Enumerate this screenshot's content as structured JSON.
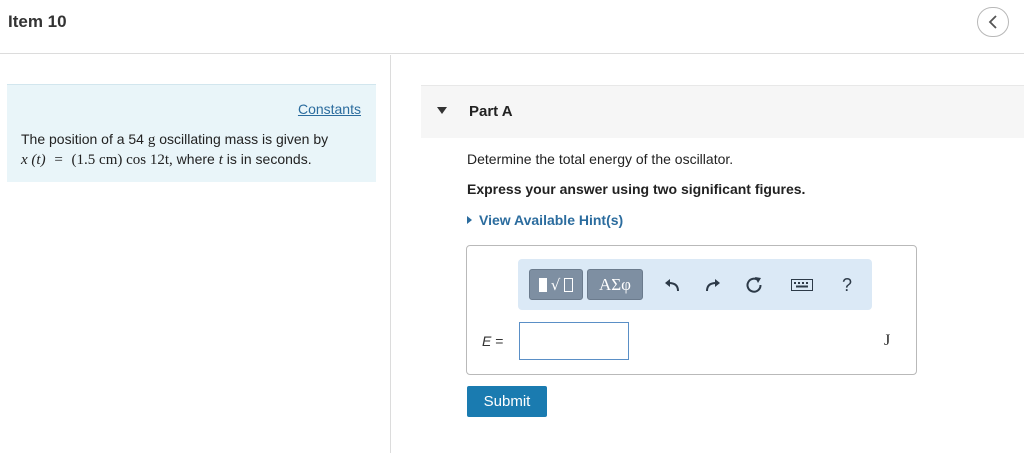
{
  "header": {
    "title": "Item 10",
    "back_icon": "chevron-left-icon"
  },
  "constants": {
    "link_label": "Constants",
    "text_line1_prefix": "The position of a 54",
    "text_line1_unit": "g",
    "text_line1_suffix": "oscillating mass is given by",
    "eq_lhs": "x (t)",
    "eq_equals": "=",
    "eq_rhs": "(1.5 cm) cos 12t,",
    "text_line2_middle": "where",
    "text_line2_var": "t",
    "text_line2_suffix": "is in seconds."
  },
  "part": {
    "title": "Part A",
    "caret_icon": "caret-down-icon",
    "question": "Determine the total energy of the oscillator.",
    "instruction": "Express your answer using two significant figures.",
    "hint_label": "View Available Hint(s)"
  },
  "toolbar": {
    "templates_icon": "templates-icon",
    "symbols_label": "ΑΣφ",
    "undo_icon": "undo-icon",
    "redo_icon": "redo-icon",
    "reset_icon": "reset-icon",
    "keyboard_icon": "keyboard-icon",
    "help_label": "?"
  },
  "answer": {
    "variable": "E",
    "equals": "=",
    "value": "",
    "unit": "J"
  },
  "submit_label": "Submit",
  "colors": {
    "accent": "#1a7bb0",
    "link": "#2b6c9e",
    "constants_bg": "#e9f5f9",
    "toolbar_bg": "#dbe9f6",
    "toolbar_button": "#7e8fa2"
  }
}
